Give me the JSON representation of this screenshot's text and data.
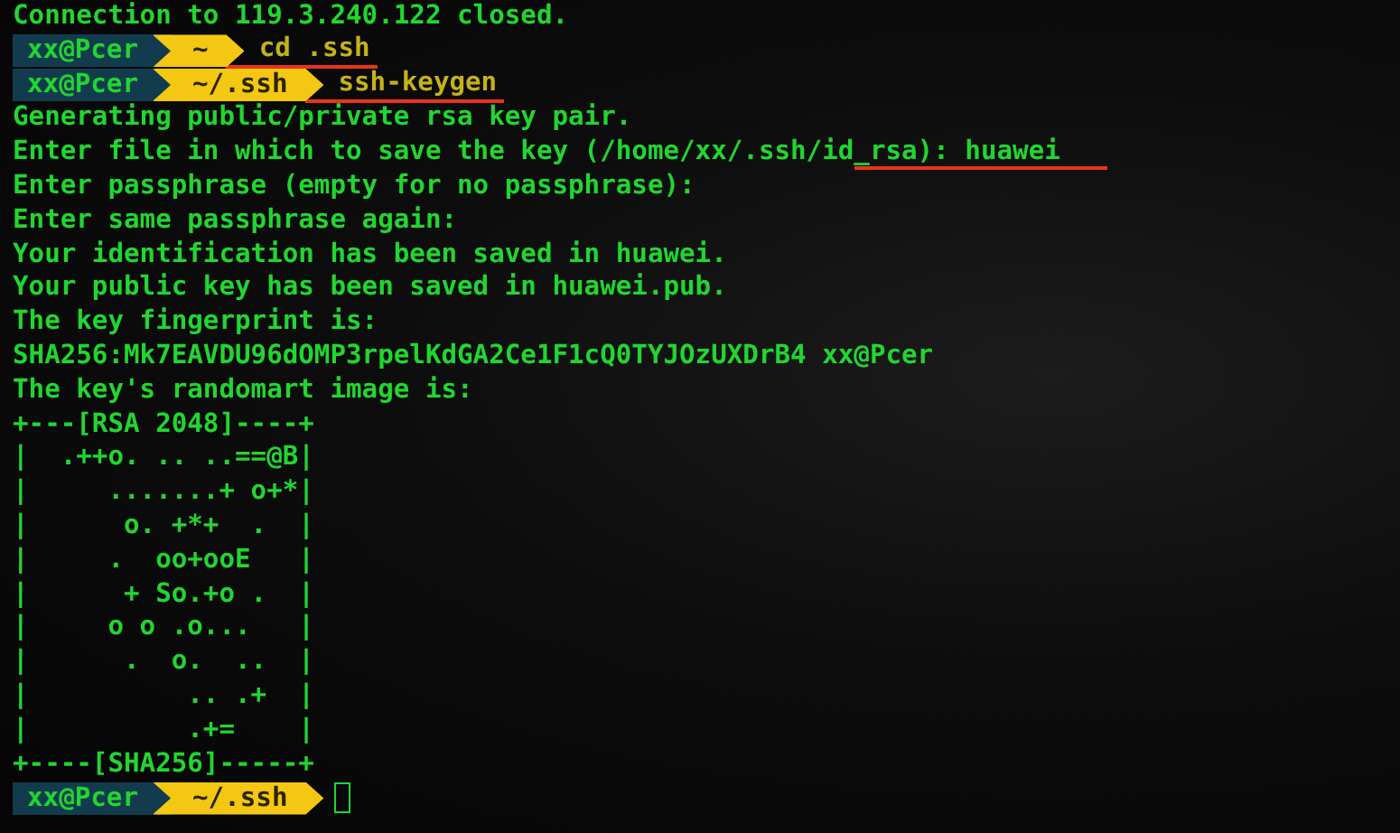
{
  "terminal": {
    "lines": [
      {
        "kind": "text",
        "text": "Connection to 119.3.240.122 closed."
      },
      {
        "kind": "prompt",
        "user": "xx@Pcer",
        "path": "~",
        "command": "cd .ssh",
        "marked": true
      },
      {
        "kind": "prompt",
        "user": "xx@Pcer",
        "path": "~/.ssh",
        "command": "ssh-keygen",
        "marked": true
      },
      {
        "kind": "text",
        "text": "Generating public/private rsa key pair."
      },
      {
        "kind": "text",
        "text": "Enter file in which to save the key (/home/xx/.ssh/id_rsa): huawei",
        "marked": true
      },
      {
        "kind": "text",
        "text": "Enter passphrase (empty for no passphrase):"
      },
      {
        "kind": "text",
        "text": "Enter same passphrase again:"
      },
      {
        "kind": "text",
        "text": "Your identification has been saved in huawei."
      },
      {
        "kind": "text",
        "text": "Your public key has been saved in huawei.pub."
      },
      {
        "kind": "text",
        "text": "The key fingerprint is:"
      },
      {
        "kind": "text",
        "text": "SHA256:Mk7EAVDU96dOMP3rpelKdGA2Ce1F1cQ0TYJOzUXDrB4 xx@Pcer"
      },
      {
        "kind": "text",
        "text": "The key's randomart image is:"
      },
      {
        "kind": "art",
        "text": "+---[RSA 2048]----+"
      },
      {
        "kind": "art",
        "text": "|  .++o. .. ..==@B|"
      },
      {
        "kind": "art",
        "text": "|     .......+ o+*|"
      },
      {
        "kind": "art",
        "text": "|      o. +*+  .  |"
      },
      {
        "kind": "art",
        "text": "|     .  oo+ooE   |"
      },
      {
        "kind": "art",
        "text": "|      + So.+o .  |"
      },
      {
        "kind": "art",
        "text": "|     o o .o...   |"
      },
      {
        "kind": "art",
        "text": "|      .  o.  ..  |"
      },
      {
        "kind": "art",
        "text": "|          .. .+  |"
      },
      {
        "kind": "art",
        "text": "|          .+=    |"
      },
      {
        "kind": "art",
        "text": "+----[SHA256]-----+"
      },
      {
        "kind": "prompt",
        "user": "xx@Pcer",
        "path": "~/.ssh",
        "cursor": true
      }
    ]
  }
}
